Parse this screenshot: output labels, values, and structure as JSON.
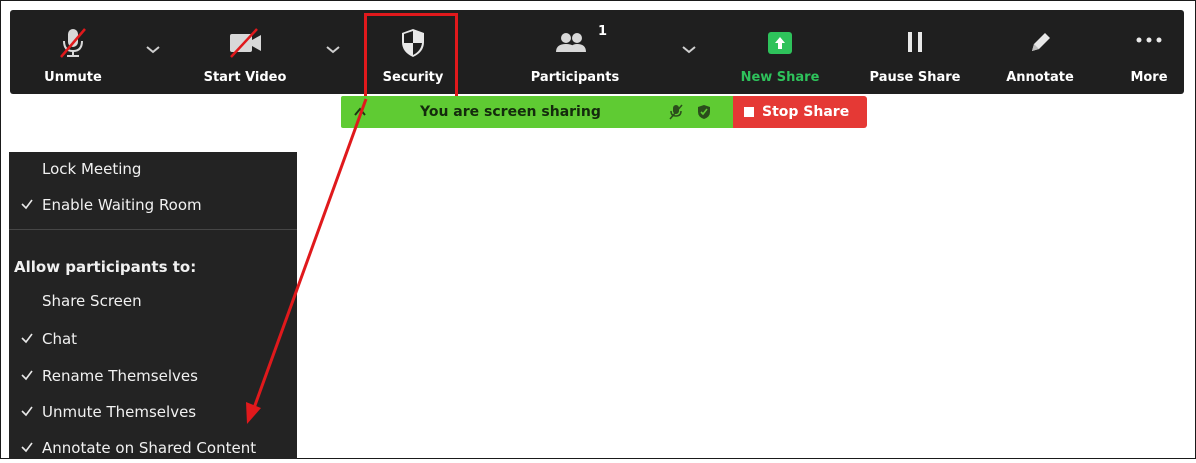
{
  "toolbar": {
    "unmute_label": "Unmute",
    "start_video_label": "Start Video",
    "security_label": "Security",
    "participants_label": "Participants",
    "participants_count": "1",
    "new_share_label": "New Share",
    "pause_share_label": "Pause Share",
    "annotate_label": "Annotate",
    "more_label": "More"
  },
  "sharing": {
    "status_text": "You are screen sharing",
    "stop_label": "Stop Share"
  },
  "security_menu": {
    "lock_meeting": "Lock Meeting",
    "waiting_room": "Enable Waiting Room",
    "allow_header": "Allow participants to:",
    "share_screen": "Share Screen",
    "chat": "Chat",
    "rename": "Rename Themselves",
    "unmute": "Unmute Themselves",
    "annotate": "Annotate on Shared Content"
  },
  "colors": {
    "toolbar_bg": "#1f1f1f",
    "new_share_green": "#2ec25b",
    "sharing_green": "#5fcb33",
    "stop_red": "#e53935",
    "highlight_red": "#e0191c"
  }
}
